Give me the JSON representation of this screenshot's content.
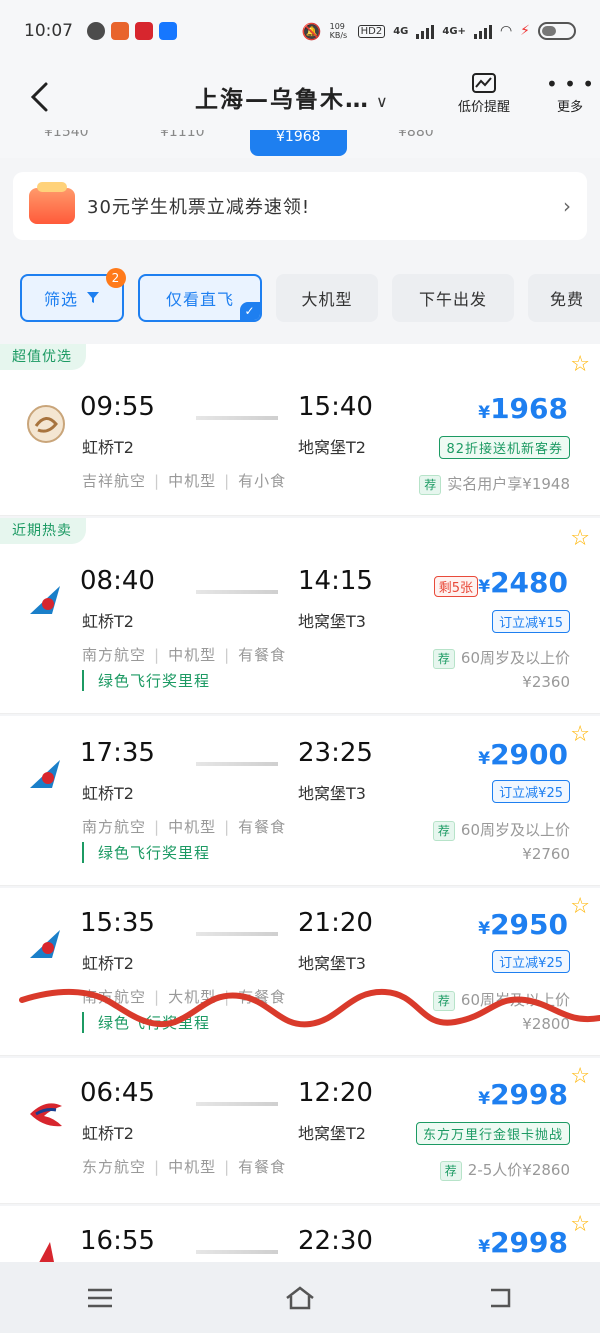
{
  "status": {
    "time": "10:07",
    "net_speed": "109\nKB/s",
    "signal1": "4G",
    "signal2": "4G+",
    "hd": "HD2"
  },
  "header": {
    "route": "上海—乌鲁木…",
    "alert_label": "低价提醒",
    "more_label": "更多"
  },
  "dates": [
    "¥1540",
    "¥1110",
    "¥1968",
    "¥880"
  ],
  "promo": {
    "text": "30元学生机票立减券速领!"
  },
  "filters": [
    {
      "label": "筛选",
      "badge": "2"
    },
    {
      "label": "仅看直飞"
    },
    {
      "label": "大机型"
    },
    {
      "label": "下午出发"
    },
    {
      "label": "免费"
    }
  ],
  "flights": [
    {
      "tag": "超值优选",
      "dep_time": "09:55",
      "dep_airport": "虹桥T2",
      "arr_time": "15:40",
      "arr_airport": "地窝堡T2",
      "airline": "吉祥航空",
      "plane": "中机型",
      "meal": "有小食",
      "price_sym": "¥",
      "price": "1968",
      "coupon": "82折接送机新客券",
      "rec_mark": "荐",
      "rec_text": "实名用户享¥1948"
    },
    {
      "tag": "近期热卖",
      "dep_time": "08:40",
      "dep_airport": "虹桥T2",
      "arr_time": "14:15",
      "arr_airport": "地窝堡T3",
      "airline": "南方航空",
      "plane": "中机型",
      "meal": "有餐食",
      "green": "绿色飞行奖里程",
      "left": "剩5张",
      "price_sym": "¥",
      "price": "2480",
      "coupon": "订立减¥15",
      "rec_mark": "荐",
      "rec_text": "60周岁及以上价",
      "rec_price": "¥2360"
    },
    {
      "dep_time": "17:35",
      "dep_airport": "虹桥T2",
      "arr_time": "23:25",
      "arr_airport": "地窝堡T3",
      "airline": "南方航空",
      "plane": "中机型",
      "meal": "有餐食",
      "green": "绿色飞行奖里程",
      "price_sym": "¥",
      "price": "2900",
      "coupon": "订立减¥25",
      "rec_mark": "荐",
      "rec_text": "60周岁及以上价",
      "rec_price": "¥2760"
    },
    {
      "dep_time": "15:35",
      "dep_airport": "虹桥T2",
      "arr_time": "21:20",
      "arr_airport": "地窝堡T3",
      "airline": "南方航空",
      "plane": "大机型",
      "meal": "有餐食",
      "green": "绿色飞行奖里程",
      "price_sym": "¥",
      "price": "2950",
      "coupon": "订立减¥25",
      "rec_mark": "荐",
      "rec_text": "60周岁及以上价",
      "rec_price": "¥2800"
    },
    {
      "dep_time": "06:45",
      "dep_airport": "虹桥T2",
      "arr_time": "12:20",
      "arr_airport": "地窝堡T2",
      "airline": "东方航空",
      "plane": "中机型",
      "meal": "有餐食",
      "price_sym": "¥",
      "price": "2998",
      "coupon": "东方万里行金银卡抛战",
      "rec_mark": "荐",
      "rec_text": "2-5人价¥2860"
    },
    {
      "dep_time": "16:55",
      "arr_time": "22:30",
      "price_sym": "¥",
      "price": "2998"
    }
  ],
  "colors": {
    "accent": "#1e7ff0",
    "green": "#1c9a63",
    "star": "#ffb400",
    "scribble": "#d93a2b"
  }
}
